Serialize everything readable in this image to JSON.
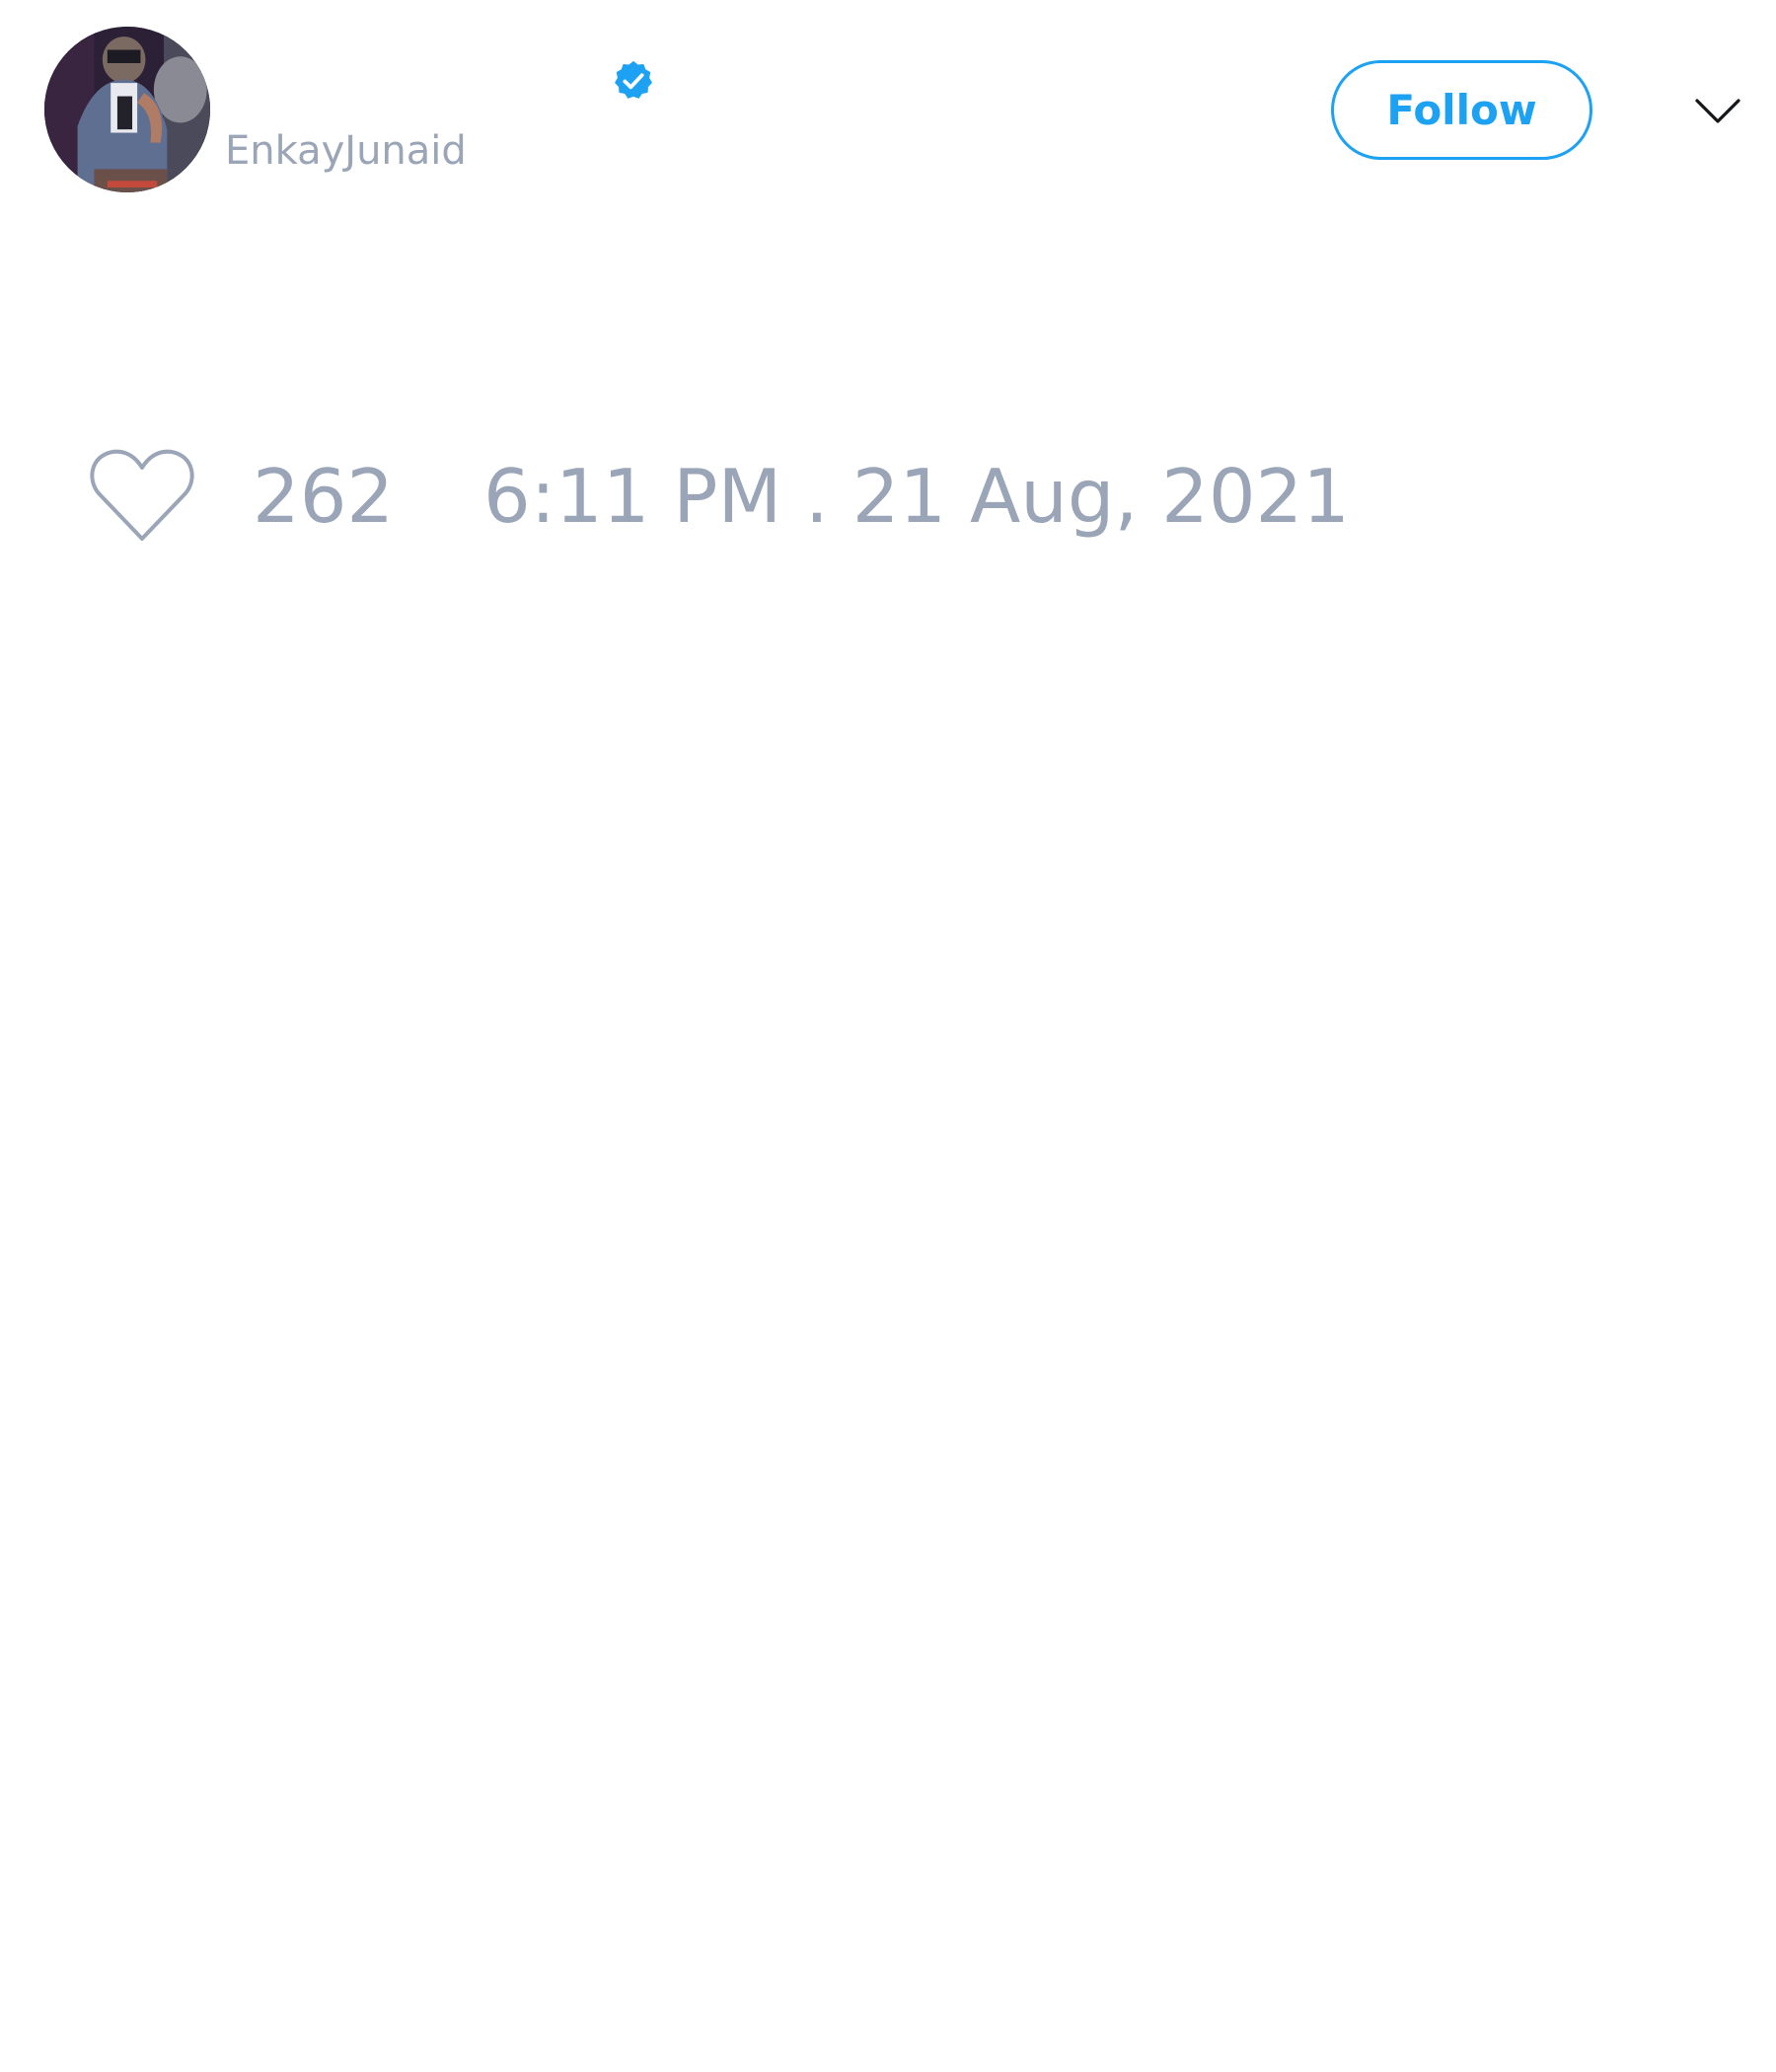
{
  "tweet": {
    "author": {
      "display_name": "",
      "username": "EnkayJunaid",
      "verified": true,
      "avatar_icon": "profile-photo"
    },
    "follow_label": "Follow",
    "menu_icon": "chevron-down-icon",
    "like_icon": "heart-outline-icon",
    "like_count": "262",
    "timestamp": "6:11 PM . 21 Aug, 2021"
  },
  "colors": {
    "accent": "#1da1f2",
    "muted_text": "#9aa5b8",
    "background": "#ffffff"
  }
}
